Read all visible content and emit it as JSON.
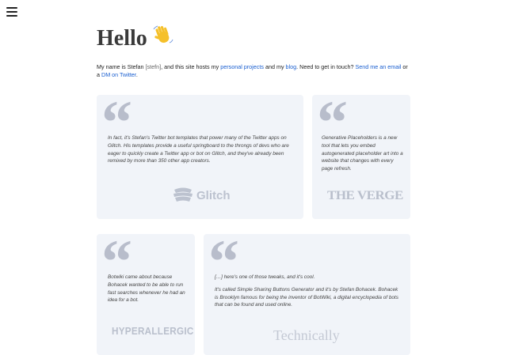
{
  "nav": {
    "menu_icon": "hamburger-menu-icon"
  },
  "header": {
    "title": "Hello",
    "emoji": "👋"
  },
  "intro": {
    "text_1": "My name is Stefan ",
    "pronunciation": "[stefn]",
    "text_2": ", and this site hosts my ",
    "link_projects": "personal projects",
    "text_3": " and my ",
    "link_blog": "blog",
    "text_4": ". Need to get in touch? ",
    "link_email": "Send me an email",
    "text_5": " or a ",
    "link_dm": "DM on Twitter",
    "text_6": "."
  },
  "quotes": [
    {
      "mark": "“",
      "paragraphs": [
        "In fact, it's Stefan's Twitter bot templates that power many of the Twitter apps on Glitch. His templates provide a useful springboard to the throngs of devs who are eager to quickly create a Twitter app or bot on Glitch, and they've already been remixed by more than 350 other app creators."
      ],
      "source": "Glitch"
    },
    {
      "mark": "“",
      "paragraphs": [
        "Generative Placeholders is a new tool that lets you embed autogenerated placeholder art into a website that changes with every page refresh."
      ],
      "source": "THE VERGE"
    },
    {
      "mark": "“",
      "paragraphs": [
        "Botwiki came about because Bohacek wanted to be able to run fast searches whenever he had an idea for a bot."
      ],
      "source": "HYPERALLERGIC"
    },
    {
      "mark": "“",
      "paragraphs": [
        "[…] here's one of those tweaks, and it's cool.",
        "It's called Simple Sharing Buttons Generator and it's by Stefan Bohacek. Bohacek is Brooklyn famous for being the inventor of BotWiki, a digital encyclopedia of bots that can be found and used online."
      ],
      "source": "Technically"
    }
  ],
  "colors": {
    "link": "#1a5fd0",
    "card_bg": "#f1f4f9",
    "quote_mark": "#b8bdcb"
  }
}
